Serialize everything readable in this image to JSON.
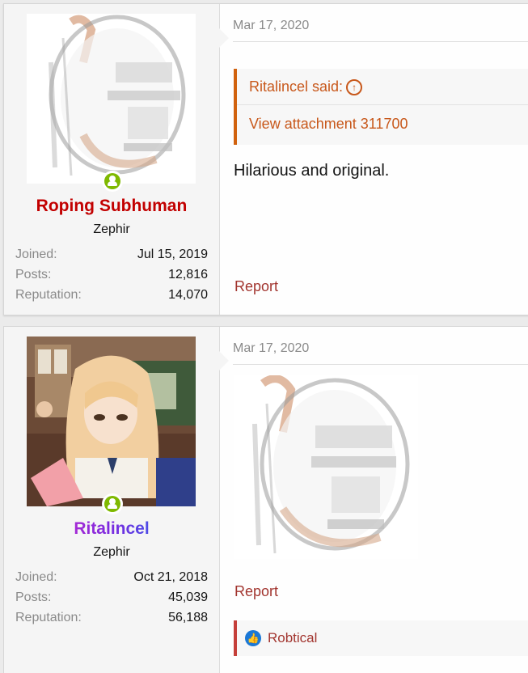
{
  "posts": [
    {
      "user": {
        "name": "Roping Subhuman",
        "title": "Zephir",
        "stats": [
          {
            "label": "Joined:",
            "value": "Jul 15, 2019"
          },
          {
            "label": "Posts:",
            "value": "12,816"
          },
          {
            "label": "Reputation:",
            "value": "14,070"
          }
        ]
      },
      "date": "Mar 17, 2020",
      "quote": {
        "author": "Ritalincel said:",
        "attachment": "View attachment 311700"
      },
      "message": "Hilarious and original.",
      "report": "Report"
    },
    {
      "user": {
        "name": "Ritalincel",
        "title": "Zephir",
        "stats": [
          {
            "label": "Joined:",
            "value": "Oct 21, 2018"
          },
          {
            "label": "Posts:",
            "value": "45,039"
          },
          {
            "label": "Reputation:",
            "value": "56,188"
          }
        ]
      },
      "date": "Mar 17, 2020",
      "report": "Report",
      "reactions": {
        "names": "Robtical"
      }
    }
  ],
  "colors": {
    "username_red": "#c20000",
    "quote_accent": "#d1620e",
    "online": "#7fb900",
    "link": "#a2352f"
  }
}
